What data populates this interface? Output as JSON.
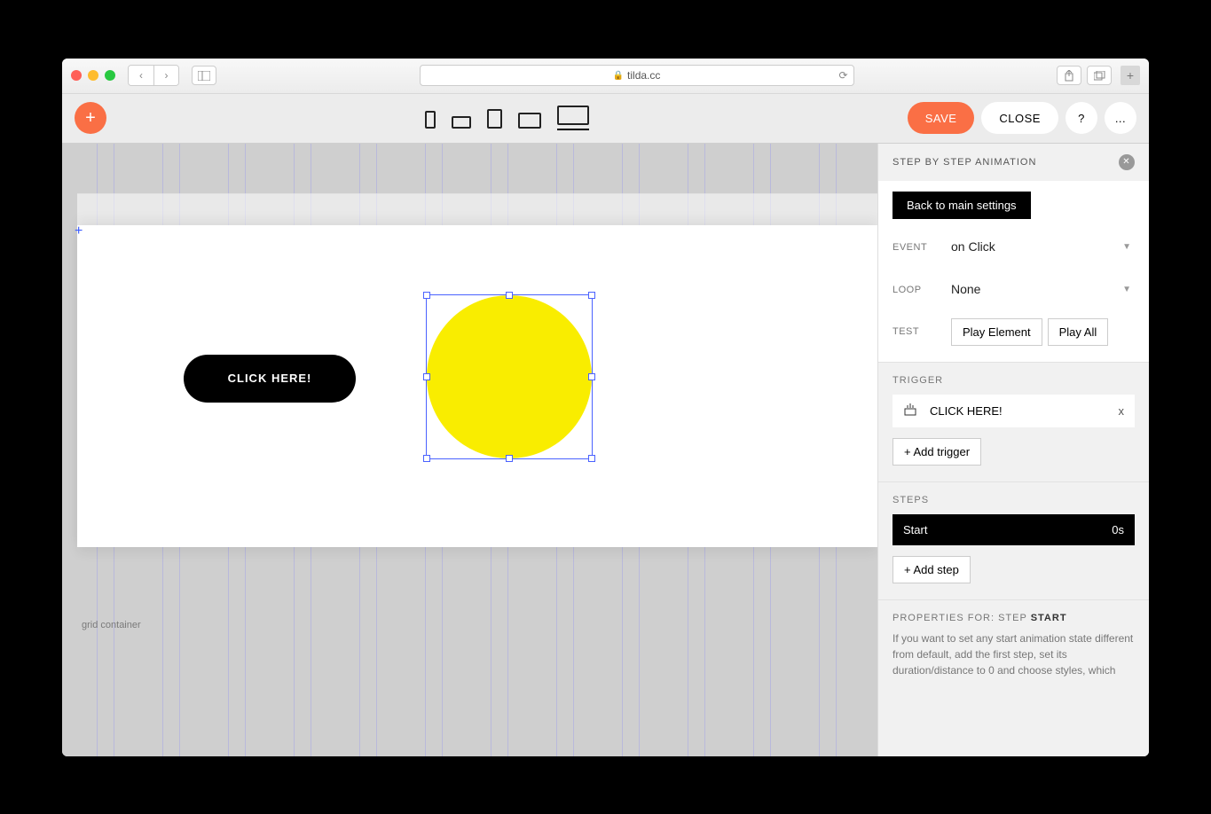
{
  "browser": {
    "url": "tilda.cc",
    "lock_icon": "🔒"
  },
  "toolbar": {
    "add_icon": "+",
    "save": "SAVE",
    "close": "CLOSE",
    "help": "?",
    "more": "..."
  },
  "canvas": {
    "button_label": "CLICK HERE!",
    "footer_label": "grid container",
    "origin_marker": "+"
  },
  "panel": {
    "title": "STEP BY STEP ANIMATION",
    "back": "Back to main settings",
    "fields": {
      "event_label": "EVENT",
      "event_value": "on Click",
      "loop_label": "LOOP",
      "loop_value": "None",
      "test_label": "TEST",
      "play_element": "Play Element",
      "play_all": "Play All"
    },
    "trigger": {
      "title": "TRIGGER",
      "item": "CLICK HERE!",
      "remove": "x",
      "add": "+ Add trigger"
    },
    "steps": {
      "title": "STEPS",
      "start_label": "Start",
      "start_time": "0s",
      "add": "+ Add step"
    },
    "props": {
      "prefix": "PROPERTIES FOR: STEP ",
      "name": "START",
      "note": "If you want to set any start animation state different from default, add the first step, set its duration/distance to 0 and choose styles, which"
    }
  }
}
